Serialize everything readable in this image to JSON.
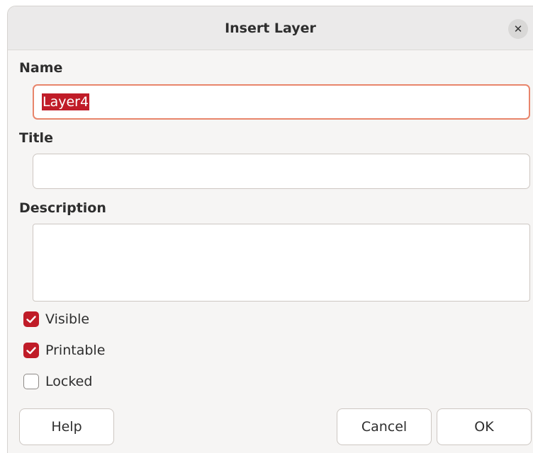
{
  "dialog": {
    "title": "Insert Layer",
    "close_icon": "close-icon"
  },
  "form": {
    "name_label": "Name",
    "name_value": "Layer4",
    "title_label": "Title",
    "title_value": "",
    "description_label": "Description",
    "description_value": ""
  },
  "options": [
    {
      "label": "Visible",
      "checked": true
    },
    {
      "label": "Printable",
      "checked": true
    },
    {
      "label": "Locked",
      "checked": false
    }
  ],
  "buttons": {
    "help": "Help",
    "cancel": "Cancel",
    "ok": "OK"
  },
  "colors": {
    "accent": "#c01c28",
    "focus_border": "#e8856b"
  }
}
